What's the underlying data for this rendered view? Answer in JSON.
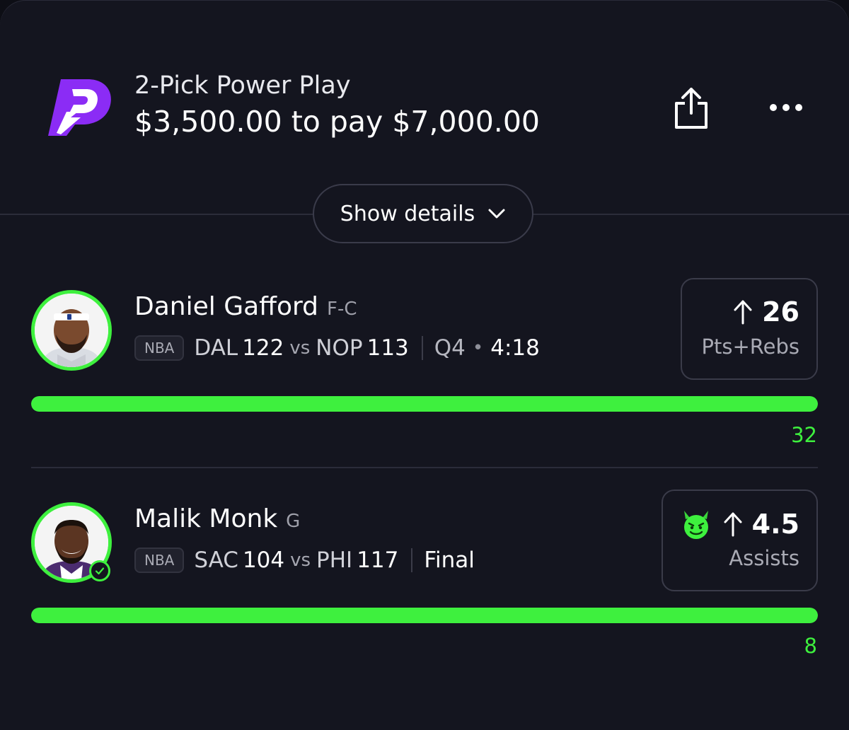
{
  "header": {
    "title": "2-Pick Power Play",
    "amount": "$3,500.00 to pay $7,000.00",
    "logo_icon": "prizepicks-logo",
    "brand_color": "#8b2cf5",
    "share_icon": "share-icon",
    "more_icon": "more-icon"
  },
  "details_toggle": {
    "label": "Show details",
    "icon": "chevron-down-icon"
  },
  "accent_color": "#3ef03e",
  "picks": [
    {
      "player_name": "Daniel Gafford",
      "position": "F-C",
      "league": "NBA",
      "team1": "DAL",
      "score1": "122",
      "vs": "vs",
      "team2": "NOP",
      "score2": "113",
      "quarter": "Q4",
      "clock": "4:18",
      "direction_icon": "arrow-up-icon",
      "line": "26",
      "stat": "Pts+Rebs",
      "actual": "32",
      "progress": 1.0
    },
    {
      "player_name": "Malik Monk",
      "position": "G",
      "league": "NBA",
      "team1": "SAC",
      "score1": "104",
      "vs": "vs",
      "team2": "PHI",
      "score2": "117",
      "status": "Final",
      "badge_icon": "demon-icon",
      "direction_icon": "arrow-up-icon",
      "line": "4.5",
      "stat": "Assists",
      "actual": "8",
      "progress": 1.0,
      "completed_icon": "check-circle-icon"
    }
  ]
}
